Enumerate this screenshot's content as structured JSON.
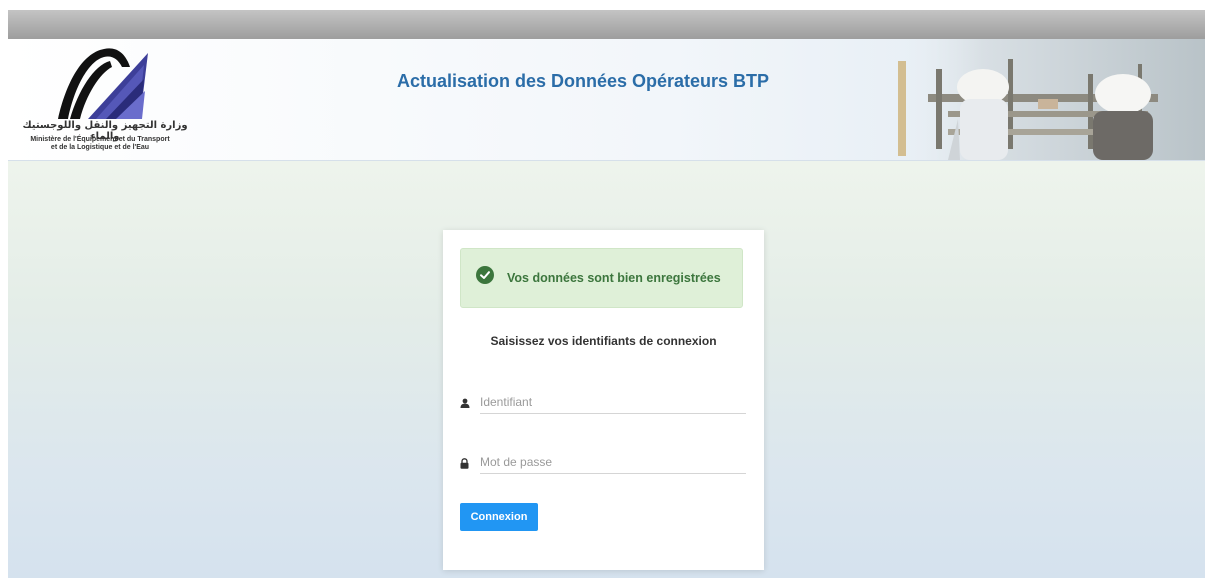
{
  "header": {
    "ministry_name_ar": "وزارة التجهيز والنقل واللوجستيك والماء",
    "ministry_name_fr_line1": "Ministère de l'Équipement et du Transport",
    "ministry_name_fr_line2": "et de la Logistique et de l'Eau",
    "title": "Actualisation des Données Opérateurs BTP"
  },
  "login": {
    "alert_message": "Vos données sont bien enregistrées",
    "instructions": "Saisissez vos identifiants de connexion",
    "username": {
      "placeholder": "Identifiant",
      "value": ""
    },
    "password": {
      "placeholder": "Mot de passe",
      "value": ""
    },
    "submit_label": "Connexion"
  },
  "icons": {
    "alert": "check-circle-icon",
    "username": "user-icon",
    "password": "lock-icon"
  },
  "colors": {
    "title": "#2b6da8",
    "alert_bg": "#dff0d8",
    "alert_text": "#3c763d",
    "button": "#2196f3"
  }
}
